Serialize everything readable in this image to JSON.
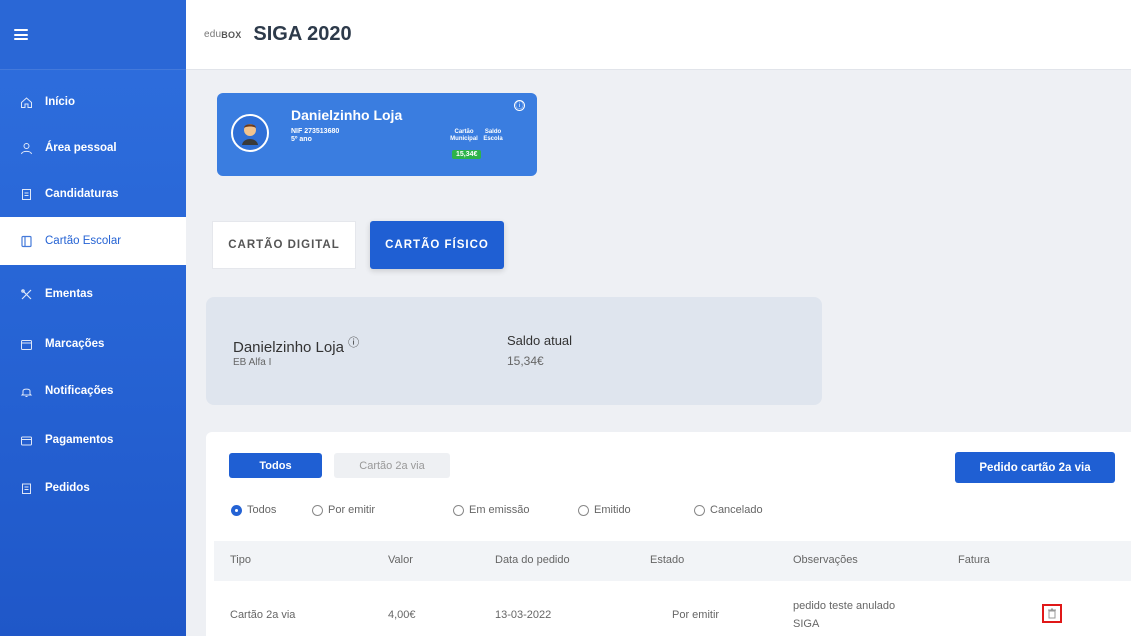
{
  "app": {
    "logo_text": "edu",
    "logo_bold": "BOX",
    "title": "SIGA 2020"
  },
  "sidebar": {
    "items": [
      {
        "label": "Início",
        "icon": "home-icon"
      },
      {
        "label": "Área pessoal",
        "icon": "user-icon"
      },
      {
        "label": "Candidaturas",
        "icon": "document-icon"
      },
      {
        "label": "Cartão Escolar",
        "icon": "card-icon",
        "active": true
      },
      {
        "label": "Ementas",
        "icon": "cutlery-icon"
      },
      {
        "label": "Marcações",
        "icon": "calendar-icon"
      },
      {
        "label": "Notificações",
        "icon": "bell-icon"
      },
      {
        "label": "Pagamentos",
        "icon": "wallet-icon"
      },
      {
        "label": "Pedidos",
        "icon": "clipboard-icon"
      }
    ]
  },
  "profile": {
    "name": "Danielzinho Loja",
    "nif": "NIF 273513680",
    "year": "5º ano",
    "col1": "Cartão Municipal",
    "col2": "Saldo Escola",
    "balance": "15,34€",
    "info_glyph": "ⓘ"
  },
  "tabs": {
    "digital": "CARTÃO DIGITAL",
    "fisico": "CARTÃO FÍSICO"
  },
  "card": {
    "name": "Danielzinho Loja",
    "info_glyph": "ⓘ",
    "school": "EB Alfa I",
    "saldo_label": "Saldo atual",
    "saldo_value": "15,34€"
  },
  "requests": {
    "filter_todos": "Todos",
    "filter_cartao": "Cartão 2a via",
    "pedido_button": "Pedido cartão 2a via",
    "radios": [
      "Todos",
      "Por emitir",
      "Em emissão",
      "Emitido",
      "Cancelado"
    ],
    "columns": [
      "Tipo",
      "Valor",
      "Data do pedido",
      "Estado",
      "Observações",
      "Fatura"
    ],
    "rows": [
      {
        "tipo": "Cartão 2a via",
        "valor": "4,00€",
        "data": "13-03-2022",
        "estado": "Por emitir",
        "obs1": "pedido teste anulado",
        "obs2": "SIGA"
      }
    ]
  },
  "colors": {
    "primary": "#1f5fd3",
    "sidebar": "#2663d4",
    "badge": "#2db34a",
    "danger": "#e01818"
  }
}
